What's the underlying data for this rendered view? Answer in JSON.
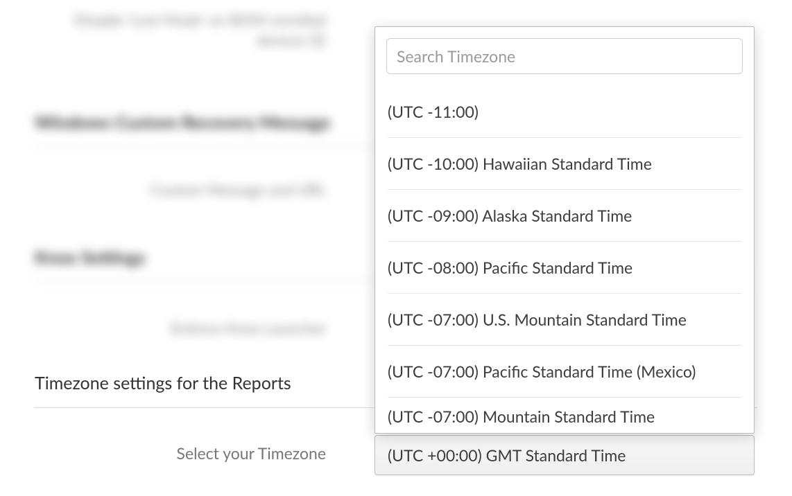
{
  "bg": {
    "row1_label": "Disable 'Lost Mode' on BOM-enrolled devices 🛈",
    "row2_heading": "Windows Custom Recovery Message",
    "row3_label": "Custom Message and URL",
    "row4_heading": "Knox Settings",
    "row5_label": "Enforce Knox Launcher"
  },
  "section": {
    "title": "Timezone settings for the Reports",
    "label": "Select your Timezone"
  },
  "search": {
    "placeholder": "Search Timezone",
    "value": ""
  },
  "selected": "(UTC +00:00) GMT Standard Time",
  "options": [
    "(UTC -11:00)",
    "(UTC -10:00) Hawaiian Standard Time",
    "(UTC -09:00) Alaska Standard Time",
    "(UTC -08:00) Pacific Standard Time",
    "(UTC -07:00) U.S. Mountain Standard Time",
    "(UTC -07:00) Pacific Standard Time (Mexico)",
    "(UTC -07:00) Mountain Standard Time"
  ]
}
